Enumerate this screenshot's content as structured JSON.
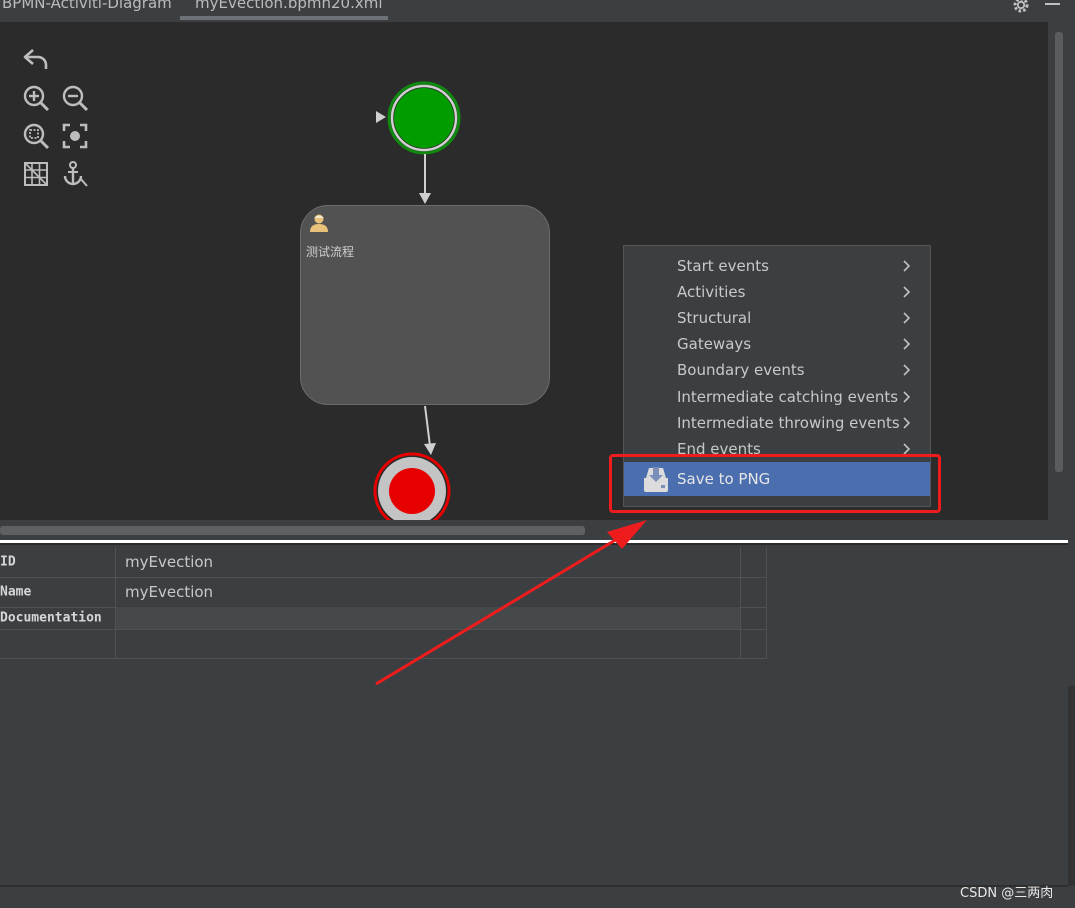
{
  "tabs": [
    {
      "label": "BPMN-Activiti-Diagram",
      "active": false
    },
    {
      "label": "myEvection.bpmn20.xml",
      "active": true
    }
  ],
  "toolbar_icons": [
    "undo-icon",
    "zoom-in-icon",
    "zoom-out-icon",
    "zoom-fit-icon",
    "focus-icon",
    "grid-icon",
    "anchor-icon"
  ],
  "diagram": {
    "task_label": "测试流程",
    "start_color": "#009c00",
    "end_color": "#e60000"
  },
  "context_menu": {
    "items": [
      {
        "label": "Start events",
        "has_submenu": true
      },
      {
        "label": "Activities",
        "has_submenu": true
      },
      {
        "label": "Structural",
        "has_submenu": true
      },
      {
        "label": "Gateways",
        "has_submenu": true
      },
      {
        "label": "Boundary events",
        "has_submenu": true
      },
      {
        "label": "Intermediate catching events",
        "has_submenu": true
      },
      {
        "label": "Intermediate throwing events",
        "has_submenu": true
      },
      {
        "label": "End events",
        "has_submenu": true
      }
    ],
    "save_label": "Save to PNG",
    "highlight_color": "#4b6eaf"
  },
  "properties": [
    {
      "key": "ID",
      "value": "myEvection"
    },
    {
      "key": "Name",
      "value": "myEvection"
    },
    {
      "key": "Documentation",
      "value": ""
    }
  ],
  "watermark": "CSDN @三两肉",
  "annotation_color": "#ee1c1c"
}
